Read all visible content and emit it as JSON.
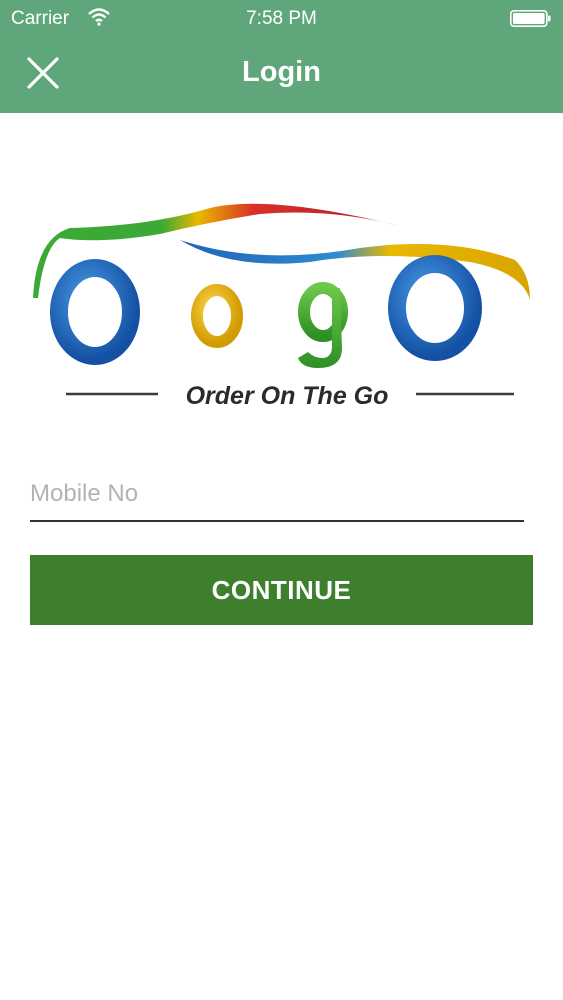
{
  "status_bar": {
    "carrier": "Carrier",
    "time": "7:58 PM",
    "icons": [
      "wifi-icon",
      "battery-icon"
    ]
  },
  "nav": {
    "title": "Login",
    "close_icon": "close-icon"
  },
  "logo": {
    "letters": [
      "O",
      "o",
      "g",
      "O"
    ],
    "tagline": "Order On The Go"
  },
  "form": {
    "mobile_placeholder": "Mobile No",
    "mobile_value": ""
  },
  "actions": {
    "continue_label": "CONTINUE"
  },
  "colors": {
    "header_green": "#5fa77b",
    "button_green": "#3d7f2c",
    "logo_blue": "#1f63b8",
    "logo_yellow": "#e9b800",
    "logo_green": "#3aa935",
    "logo_red": "#d8312a"
  }
}
